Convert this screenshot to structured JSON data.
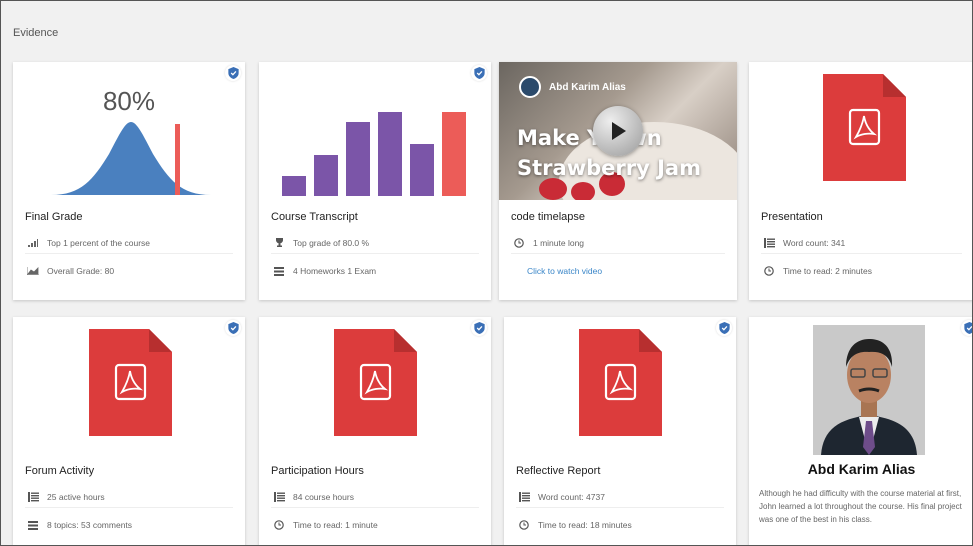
{
  "section_title": "Evidence",
  "colors": {
    "accent_blue": "#3a6fb6",
    "pdf_red": "#dc3c3c",
    "bar_purple": "#7b55a8",
    "bar_coral": "#ec5c58",
    "link": "#3a86c8"
  },
  "cards": {
    "final_grade": {
      "title": "Final Grade",
      "percent": "80%",
      "marker_percent": 80,
      "meta1_icon": "signal-bars-icon",
      "meta1": "Top 1 percent of the course",
      "meta2_icon": "area-chart-icon",
      "meta2": "Overall Grade: 80"
    },
    "course_transcript": {
      "title": "Course Transcript",
      "bar_heights": [
        22,
        45,
        80,
        91,
        57,
        91
      ],
      "meta1_icon": "trophy-icon",
      "meta1": "Top grade of 80.0 %",
      "meta2_icon": "list-icon",
      "meta2": "4 Homeworks 1 Exam"
    },
    "code_timelapse": {
      "title": "code timelapse",
      "video_author": "Abd Karim Alias",
      "video_line1": "Make Y     Own",
      "video_line2": "Strawberry Jam",
      "meta1_icon": "clock-icon",
      "meta1": "1 minute long",
      "meta2": "Click to watch video"
    },
    "presentation": {
      "title": "Presentation",
      "meta1_icon": "text-lines-icon",
      "meta1": "Word count: 341",
      "meta2_icon": "clock-icon",
      "meta2": "Time to read: 2 minutes"
    },
    "forum_activity": {
      "title": "Forum Activity",
      "meta1_icon": "text-lines-icon",
      "meta1": "25 active hours",
      "meta2_icon": "list-icon",
      "meta2": "8 topics: 53 comments"
    },
    "participation_hours": {
      "title": "Participation Hours",
      "meta1_icon": "text-lines-icon",
      "meta1": "84 course hours",
      "meta2_icon": "clock-icon",
      "meta2": "Time to read: 1 minute"
    },
    "reflective_report": {
      "title": "Reflective Report",
      "meta1_icon": "text-lines-icon",
      "meta1": "Word count: 4737",
      "meta2_icon": "clock-icon",
      "meta2": "Time to read: 18 minutes"
    },
    "profile": {
      "name": "Abd Karim Alias",
      "quote": "Although he had difficulty with the course material at first, John learned a lot throughout the course. His final project was one of the best in his class."
    }
  }
}
